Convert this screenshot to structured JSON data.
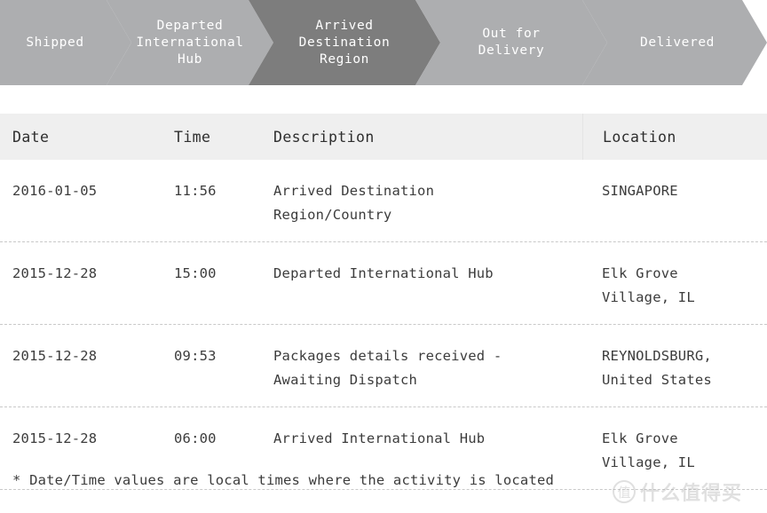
{
  "tracker": {
    "active_color": "#7D7D7D",
    "inactive_color": "#ADAEB0",
    "steps": [
      {
        "label": "Shipped",
        "state": "inactive"
      },
      {
        "label": "Departed\nInternational\nHub",
        "state": "inactive"
      },
      {
        "label": "Arrived\nDestination\nRegion",
        "state": "active"
      },
      {
        "label": "Out for\nDelivery",
        "state": "inactive"
      },
      {
        "label": "Delivered",
        "state": "inactive"
      }
    ]
  },
  "table": {
    "headers": {
      "date": "Date",
      "time": "Time",
      "description": "Description",
      "location": "Location"
    },
    "rows": [
      {
        "date": "2016-01-05",
        "time": "11:56",
        "description": "Arrived Destination\nRegion/Country",
        "location": "SINGAPORE"
      },
      {
        "date": "2015-12-28",
        "time": "15:00",
        "description": "Departed International Hub",
        "location": "Elk Grove\nVillage, IL"
      },
      {
        "date": "2015-12-28",
        "time": "09:53",
        "description": "Packages details received  -\nAwaiting Dispatch",
        "location": "REYNOLDSBURG,\nUnited States"
      },
      {
        "date": "2015-12-28",
        "time": "06:00",
        "description": "Arrived International Hub",
        "location": "Elk Grove\nVillage, IL"
      }
    ]
  },
  "footer": {
    "note": "* Date/Time values are local times where the activity is located"
  },
  "watermark": {
    "logo_glyph": "值",
    "text": "什么值得买"
  }
}
